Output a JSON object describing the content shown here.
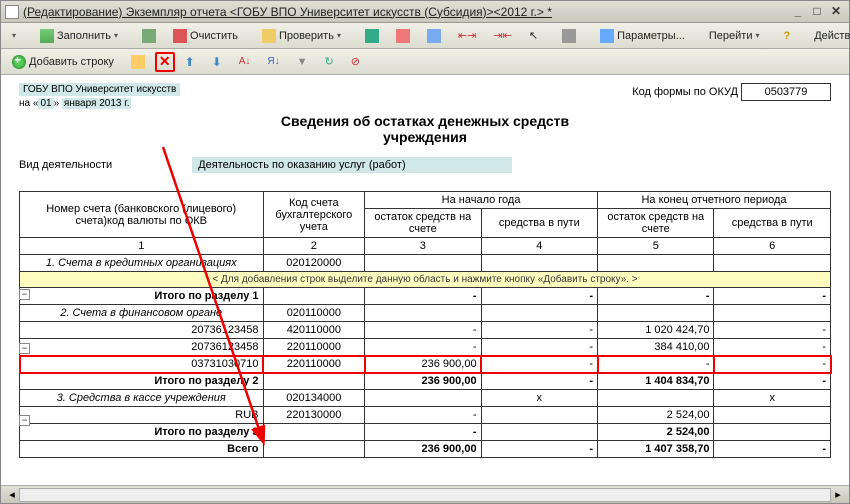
{
  "window": {
    "title": "(Редактирование) Экземпляр отчета <ГОБУ ВПО Университет искусств (Субсидия)><2012 г.> *"
  },
  "toolbar1": {
    "fill": "Заполнить",
    "clear": "Очистить",
    "check": "Проверить",
    "params": "Параметры...",
    "go": "Перейти",
    "actions": "Действия"
  },
  "toolbar2": {
    "addRow": "Добавить строку"
  },
  "header": {
    "org": "ГОБУ ВПО Университет искусств",
    "datePrefix": "на «",
    "dateDay": "01",
    "dateMid": "» ",
    "dateRest": "января 2013 г.",
    "okudLabel": "Код формы по ОКУД",
    "okudValue": "0503779"
  },
  "docTitle": "Сведения об остатках денежных средств<br>учреждения",
  "activity": {
    "label": "Вид деятельности",
    "value": "Деятельность по оказанию услуг (работ)"
  },
  "table": {
    "h_account": "Номер счета (банковского (лицевого) счета)код валюты по ОКВ",
    "h_code": "Код счета бухгалтерского учета",
    "h_begin": "На начало года",
    "h_end": "На конец отчетного периода",
    "h_balance": "остаток средств на счете",
    "h_transit": "средства в пути",
    "c1": "1",
    "c2": "2",
    "c3": "3",
    "c4": "4",
    "c5": "5",
    "c6": "6",
    "addHint": "< Для добавления строк выделите данную область и нажмите кнопку «Добавить строку». >",
    "s1": {
      "title": "1. Счета в кредитных организациях",
      "code": "020120000",
      "subtotal": "Итого по разделу 1"
    },
    "s2": {
      "title": "2. Счета в финансовом органе",
      "code": "020110000",
      "r1": {
        "acc": "20736123458",
        "code": "420110000",
        "end_bal": "1 020 424,70"
      },
      "r2": {
        "acc": "20736123458",
        "code": "220110000",
        "end_bal": "384 410,00"
      },
      "r3": {
        "acc": "03731030710",
        "code": "220110000",
        "beg_bal": "236 900,00"
      },
      "subtotal": "Итого по разделу 2",
      "sub_beg": "236 900,00",
      "sub_end": "1 404 834,70"
    },
    "s3": {
      "title": "3. Средства в кассе учреждения",
      "code": "020134000",
      "r1": {
        "acc": "RUB",
        "code": "220130000",
        "end_bal": "2 524,00"
      },
      "subtotal": "Итого по разделу 3",
      "sub_end": "2 524,00"
    },
    "grand": {
      "label": "Всего",
      "beg": "236 900,00",
      "end": "1 407 358,70"
    },
    "dash": "-",
    "x": "x"
  }
}
